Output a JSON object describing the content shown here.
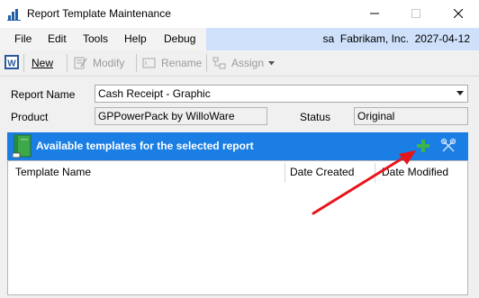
{
  "window": {
    "title": "Report Template Maintenance",
    "icon": "bar-chart-icon",
    "controls": [
      "minimize-icon",
      "maximize-icon",
      "close-icon"
    ]
  },
  "menu": {
    "items": [
      "File",
      "Edit",
      "Tools",
      "Help",
      "Debug"
    ],
    "user": "sa",
    "company": "Fabrikam, Inc.",
    "date": "2027-04-12"
  },
  "toolbar": {
    "new": "New",
    "modify": "Modify",
    "rename": "Rename",
    "assign": "Assign"
  },
  "form": {
    "report_name_label": "Report Name",
    "report_name_value": "Cash Receipt - Graphic",
    "product_label": "Product",
    "product_value": "GPPowerPack by WilloWare",
    "status_label": "Status",
    "status_value": "Original"
  },
  "templates": {
    "title": "Available templates for the selected report",
    "columns": [
      "Template Name",
      "Date Created",
      "Date Modified"
    ],
    "rows": []
  },
  "colors": {
    "band": "#1a7ee4",
    "company_bar": "#cfe0fb",
    "annotation_arrow": "#e8141a",
    "add_icon": "#3bb54a"
  }
}
